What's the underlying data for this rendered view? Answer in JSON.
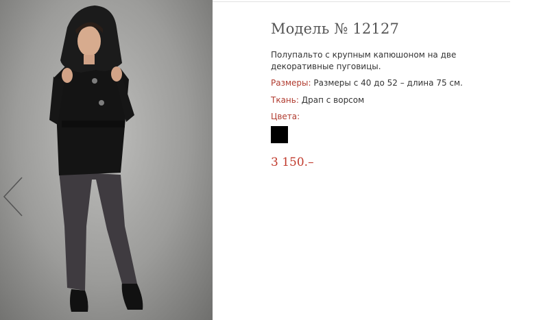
{
  "product": {
    "title": "Модель № 12127",
    "description": "Полупальто с крупным капюшоном на две декоративные пуговицы.",
    "sizes_label": "Размеры:",
    "sizes_value": "Размеры с 40 до 52 – длина 75 см.",
    "fabric_label": "Ткань:",
    "fabric_value": "Драп с ворсом",
    "colors_label": "Цвета:",
    "colors": [
      "#000000"
    ],
    "price": "3 150.–"
  },
  "gallery": {
    "prev_icon": "chevron-left-icon"
  }
}
